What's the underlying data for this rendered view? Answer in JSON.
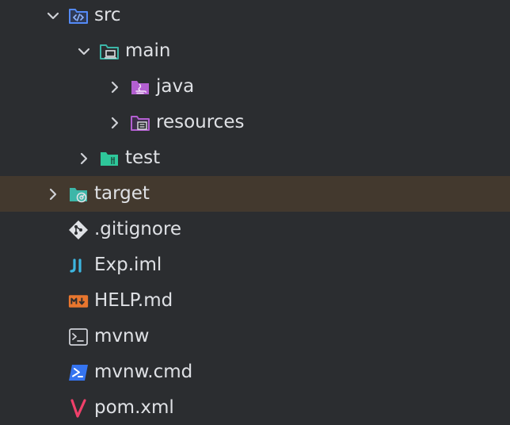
{
  "tree": {
    "items": [
      {
        "label": "src",
        "icon": "source-folder-icon",
        "expanded": true
      },
      {
        "label": "main",
        "icon": "module-folder-icon",
        "expanded": true
      },
      {
        "label": "java",
        "icon": "java-folder-icon",
        "expanded": false
      },
      {
        "label": "resources",
        "icon": "resources-folder-icon",
        "expanded": false
      },
      {
        "label": "test",
        "icon": "test-folder-icon",
        "expanded": false
      },
      {
        "label": "target",
        "icon": "excluded-folder-icon",
        "expanded": false,
        "selected": true
      },
      {
        "label": ".gitignore",
        "icon": "git-icon"
      },
      {
        "label": "Exp.iml",
        "icon": "iml-icon"
      },
      {
        "label": "HELP.md",
        "icon": "markdown-icon"
      },
      {
        "label": "mvnw",
        "icon": "terminal-icon"
      },
      {
        "label": "mvnw.cmd",
        "icon": "powershell-icon"
      },
      {
        "label": "pom.xml",
        "icon": "maven-icon"
      }
    ]
  },
  "colors": {
    "background": "#2b2d30",
    "selected_row": "#43392e",
    "text": "#dfe1e5",
    "chevron": "#cfd1d6",
    "source_folder": "#548af7",
    "module_folder": "#3cb6a8",
    "java_folder": "#b35fd1",
    "test_folder": "#2ec79a",
    "markdown": "#e8762e",
    "powershell": "#3574f0",
    "maven": "#f0406a"
  }
}
